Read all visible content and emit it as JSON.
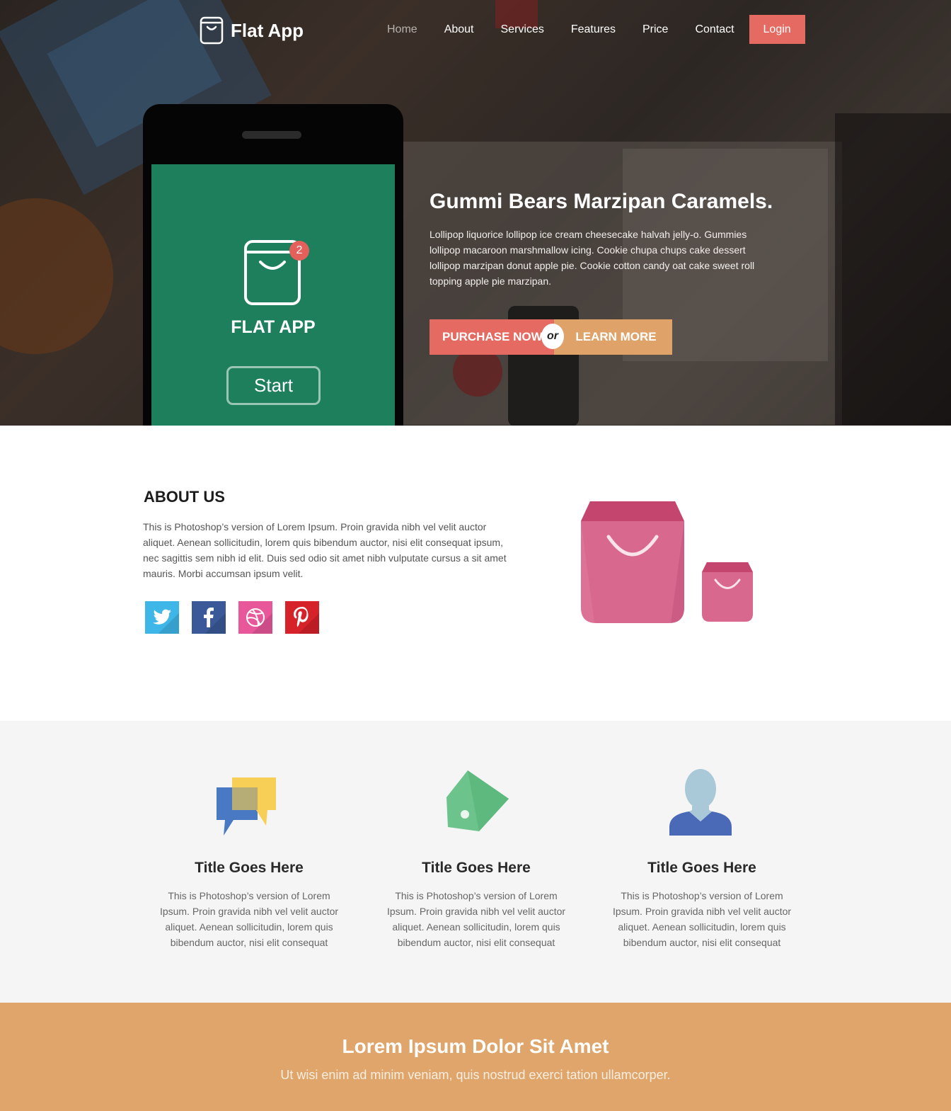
{
  "header": {
    "logo_text": "Flat App",
    "nav": [
      "Home",
      "About",
      "Services",
      "Features",
      "Price",
      "Contact"
    ],
    "active_nav": "Home",
    "login_label": "Login"
  },
  "hero": {
    "phone": {
      "badge_count": "2",
      "app_title": "FLAT APP",
      "start_label": "Start"
    },
    "title": "Gummi Bears Marzipan Caramels.",
    "text": "Lollipop liquorice lollipop ice cream cheesecake halvah jelly-o. Gummies lollipop macaroon marshmallow icing. Cookie chupa chups cake dessert lollipop marzipan donut apple pie. Cookie cotton candy oat cake sweet roll topping apple pie marzipan.",
    "purchase_label": "PURCHASE NOW",
    "or_label": "or",
    "learn_label": "LEARN MORE"
  },
  "about": {
    "title": "ABOUT US",
    "text": "This is Photoshop’s version  of Lorem Ipsum. Proin gravida nibh vel velit auctor aliquet. Aenean sollicitudin, lorem quis bibendum auctor, nisi elit consequat ipsum, nec sagittis sem nibh id elit. Duis sed odio sit amet nibh vulputate cursus a sit amet mauris. Morbi accumsan ipsum velit.",
    "socials": [
      {
        "name": "twitter-icon",
        "color": "#3fb6e8"
      },
      {
        "name": "facebook-icon",
        "color": "#3b5998"
      },
      {
        "name": "dribbble-icon",
        "color": "#e8579a"
      },
      {
        "name": "pinterest-icon",
        "color": "#d62229"
      }
    ]
  },
  "features": [
    {
      "icon": "chat-bubbles-icon",
      "title": "Title Goes Here",
      "text": "This is Photoshop’s version  of Lorem Ipsum. Proin gravida nibh vel velit auctor aliquet. Aenean sollicitudin, lorem quis bibendum auctor, nisi elit consequat"
    },
    {
      "icon": "tag-icon",
      "title": "Title Goes Here",
      "text": "This is Photoshop’s version  of Lorem Ipsum. Proin gravida nibh vel velit auctor aliquet. Aenean sollicitudin, lorem quis bibendum auctor, nisi elit consequat"
    },
    {
      "icon": "user-icon",
      "title": "Title Goes Here",
      "text": "This is Photoshop’s version  of Lorem Ipsum. Proin gravida nibh vel velit auctor aliquet. Aenean sollicitudin, lorem quis bibendum auctor, nisi elit consequat"
    }
  ],
  "cta": {
    "title": "Lorem Ipsum Dolor Sit Amet",
    "text": "Ut wisi enim ad minim veniam, quis nostrud exerci tation ullamcorper."
  },
  "colors": {
    "accent_red": "#e46a62",
    "accent_orange": "#dfa56b",
    "phone_green": "#1e7f5c",
    "bag_pink": "#d9688f"
  }
}
